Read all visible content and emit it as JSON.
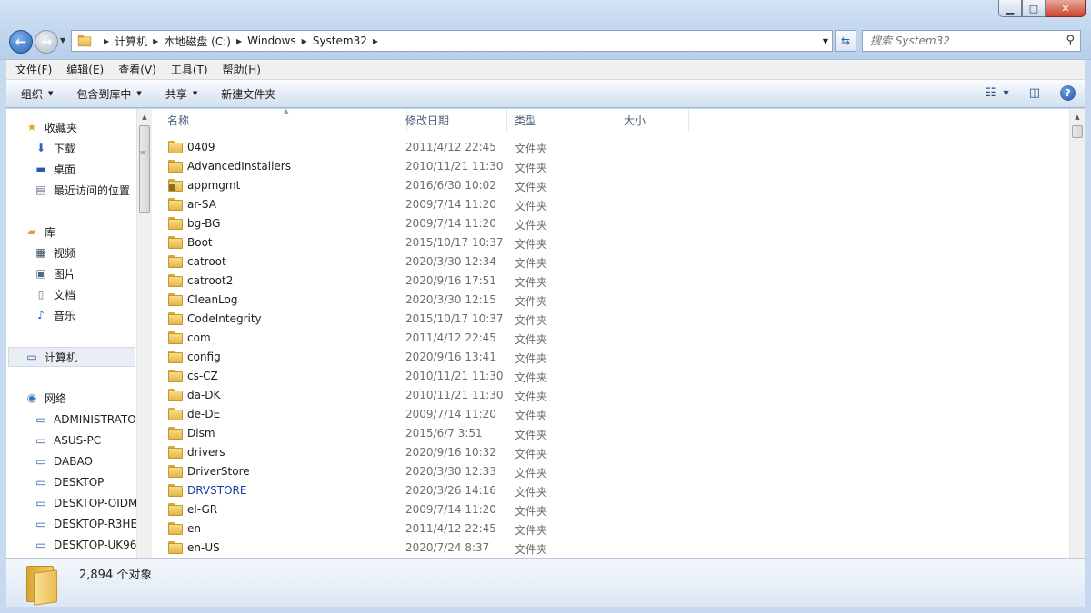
{
  "window": {
    "minimize": "▁",
    "maximize": "□",
    "close": "✕"
  },
  "address": {
    "crumbs": [
      "计算机",
      "本地磁盘 (C:)",
      "Windows",
      "System32"
    ],
    "search_placeholder": "搜索 System32"
  },
  "menu": [
    "文件(F)",
    "编辑(E)",
    "查看(V)",
    "工具(T)",
    "帮助(H)"
  ],
  "toolbar": {
    "organize": "组织",
    "include_library": "包含到库中",
    "share": "共享",
    "new_folder": "新建文件夹"
  },
  "nav": {
    "favorites": "收藏夹",
    "downloads": "下载",
    "desktop": "桌面",
    "recent": "最近访问的位置",
    "libraries": "库",
    "videos": "视频",
    "pictures": "图片",
    "documents": "文档",
    "music": "音乐",
    "computer": "计算机",
    "network": "网络",
    "network_items": [
      "ADMINISTRATOR",
      "ASUS-PC",
      "DABAO",
      "DESKTOP",
      "DESKTOP-OIDM",
      "DESKTOP-R3HE",
      "DESKTOP-UK96"
    ]
  },
  "columns": {
    "name": "名称",
    "modified": "修改日期",
    "type": "类型",
    "size": "大小"
  },
  "files": [
    {
      "name": "0409",
      "date": "2011/4/12 22:45",
      "type": "文件夹"
    },
    {
      "name": "AdvancedInstallers",
      "date": "2010/11/21 11:30",
      "type": "文件夹"
    },
    {
      "name": "appmgmt",
      "date": "2016/6/30 10:02",
      "type": "文件夹",
      "locked": true
    },
    {
      "name": "ar-SA",
      "date": "2009/7/14 11:20",
      "type": "文件夹"
    },
    {
      "name": "bg-BG",
      "date": "2009/7/14 11:20",
      "type": "文件夹"
    },
    {
      "name": "Boot",
      "date": "2015/10/17 10:37",
      "type": "文件夹"
    },
    {
      "name": "catroot",
      "date": "2020/3/30 12:34",
      "type": "文件夹"
    },
    {
      "name": "catroot2",
      "date": "2020/9/16 17:51",
      "type": "文件夹"
    },
    {
      "name": "CleanLog",
      "date": "2020/3/30 12:15",
      "type": "文件夹"
    },
    {
      "name": "CodeIntegrity",
      "date": "2015/10/17 10:37",
      "type": "文件夹"
    },
    {
      "name": "com",
      "date": "2011/4/12 22:45",
      "type": "文件夹"
    },
    {
      "name": "config",
      "date": "2020/9/16 13:41",
      "type": "文件夹"
    },
    {
      "name": "cs-CZ",
      "date": "2010/11/21 11:30",
      "type": "文件夹"
    },
    {
      "name": "da-DK",
      "date": "2010/11/21 11:30",
      "type": "文件夹"
    },
    {
      "name": "de-DE",
      "date": "2009/7/14 11:20",
      "type": "文件夹"
    },
    {
      "name": "Dism",
      "date": "2015/6/7 3:51",
      "type": "文件夹"
    },
    {
      "name": "drivers",
      "date": "2020/9/16 10:32",
      "type": "文件夹"
    },
    {
      "name": "DriverStore",
      "date": "2020/3/30 12:33",
      "type": "文件夹"
    },
    {
      "name": "DRVSTORE",
      "date": "2020/3/26 14:16",
      "type": "文件夹",
      "highlight": true
    },
    {
      "name": "el-GR",
      "date": "2009/7/14 11:20",
      "type": "文件夹"
    },
    {
      "name": "en",
      "date": "2011/4/12 22:45",
      "type": "文件夹"
    },
    {
      "name": "en-US",
      "date": "2020/7/24 8:37",
      "type": "文件夹"
    }
  ],
  "status": {
    "count": "2,894 个对象"
  },
  "colors": {
    "accent": "#2a64b4",
    "highlight_text": "#1f3fa0"
  }
}
